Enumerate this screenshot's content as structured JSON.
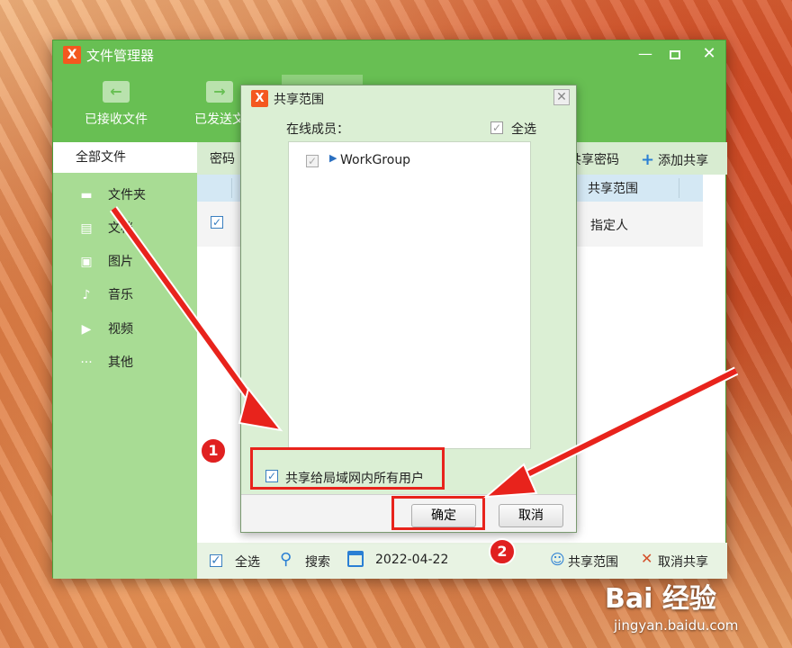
{
  "window": {
    "logo": "X",
    "title": "文件管理器",
    "controls": {
      "minimize": "—",
      "close": "✕"
    }
  },
  "toolbar": {
    "received_label": "已接收文件",
    "sent_label": "已发送文",
    "received_icon": "arrow-left-folder-icon",
    "sent_icon": "arrow-right-folder-icon"
  },
  "sidebar": {
    "all_files": "全部文件",
    "items": [
      {
        "label": "文件夹",
        "icon": "folder-icon",
        "glyph": "▬"
      },
      {
        "label": "文档",
        "icon": "document-icon",
        "glyph": "▤"
      },
      {
        "label": "图片",
        "icon": "image-icon",
        "glyph": "▣"
      },
      {
        "label": "音乐",
        "icon": "music-icon",
        "glyph": "♪"
      },
      {
        "label": "视频",
        "icon": "video-icon",
        "glyph": "▶"
      },
      {
        "label": "其他",
        "icon": "more-icon",
        "glyph": "···"
      }
    ]
  },
  "content": {
    "header_left": "密码",
    "share_password": "共享密码",
    "add_share": "添加共享",
    "add_share_icon": "+",
    "column_share_scope": "共享范围",
    "rows": [
      {
        "checked": "✓",
        "scope": "指定人"
      }
    ]
  },
  "footer": {
    "select_all_check": "✓",
    "select_all": "全选",
    "search_glyph": "🔍",
    "search": "搜索",
    "date": "2022-04-22",
    "share_scope_glyph": "👥",
    "share_scope": "共享范围",
    "cancel_share_glyph": "✕",
    "cancel_share": "取消共享"
  },
  "dialog": {
    "logo": "X",
    "title": "共享范围",
    "close_glyph": "✕",
    "online_members_label": "在线成员：",
    "select_all_check": "✓",
    "select_all": "全选",
    "tree": [
      {
        "check": "✓",
        "arrow": "▶",
        "label": "WorkGroup"
      }
    ],
    "lan_check": "✓",
    "share_lan_all": "共享给局域网内所有用户",
    "ok": "确定",
    "cancel": "取消"
  },
  "annotations": {
    "badge_1": "1",
    "badge_2": "2",
    "highlight_color": "#e8231c"
  },
  "watermark": {
    "brand": "Bai 经验",
    "url": "jingyan.baidu.com"
  }
}
